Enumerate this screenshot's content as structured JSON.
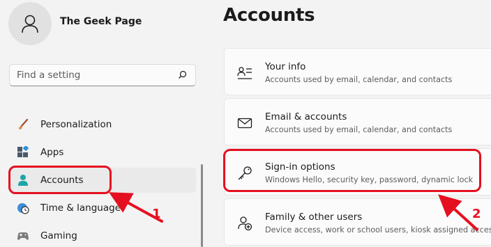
{
  "user": {
    "name": "The Geek Page"
  },
  "search": {
    "placeholder": "Find a setting"
  },
  "sidebar": {
    "items": [
      {
        "label": "Personalization",
        "icon": "brush-icon",
        "selected": false
      },
      {
        "label": "Apps",
        "icon": "apps-icon",
        "selected": false
      },
      {
        "label": "Accounts",
        "icon": "person-icon",
        "selected": true
      },
      {
        "label": "Time & language",
        "icon": "clock-globe-icon",
        "selected": false
      },
      {
        "label": "Gaming",
        "icon": "gamepad-icon",
        "selected": false
      }
    ]
  },
  "main": {
    "title": "Accounts",
    "cards": [
      {
        "title": "Your info",
        "desc": "Accounts used by email, calendar, and contacts",
        "icon": "person-card-icon"
      },
      {
        "title": "Email & accounts",
        "desc": "Accounts used by email, calendar, and contacts",
        "icon": "mail-icon"
      },
      {
        "title": "Sign-in options",
        "desc": "Windows Hello, security key, password, dynamic lock",
        "icon": "key-icon"
      },
      {
        "title": "Family & other users",
        "desc": "Device access, work or school users, kiosk assigned access",
        "icon": "family-icon"
      }
    ]
  },
  "annotations": {
    "step1": "1",
    "step2": "2",
    "color": "#e5101f"
  },
  "colors": {
    "accent": "#0067c0",
    "window_bg": "#f3f3f3",
    "card_bg": "#fbfbfb"
  }
}
